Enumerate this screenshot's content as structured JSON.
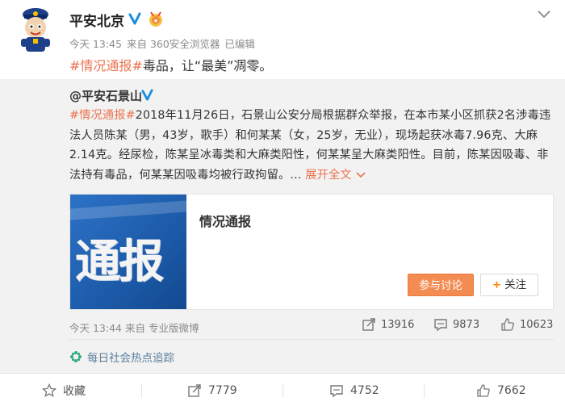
{
  "post": {
    "username": "平安北京",
    "meta_time": "今天 13:45",
    "meta_from": "来自 360安全浏览器",
    "meta_edited": "已编辑",
    "text_hashtag": "#情况通报#",
    "text_body": "毒品，让“最美”凋零。"
  },
  "repost": {
    "author": "@平安石景山",
    "text_hashtag": "#情况通报#",
    "text_body": "2018年11月26日，石景山公安分局根据群众举报，在本市某小区抓获2名涉毒违法人员陈某（男，43岁，歌手）和何某某（女，25岁，无业），现场起获冰毒7.96克、大麻2.14克。经尿检，陈某呈冰毒类和大麻类阳性，何某某呈大麻类阳性。目前，陈某因吸毒、非法持有毒品，何某某因吸毒均被行政拘留。...",
    "expand_label": "展开全文",
    "card": {
      "image_text": "通报",
      "title": "情况通报",
      "discuss_label": "参与讨论",
      "follow_label": "关注"
    },
    "meta": "今天 13:44 来自 专业版微博",
    "stats": {
      "reposts": "13916",
      "comments": "9873",
      "likes": "10623"
    },
    "topic_label": "每日社会热点追踪"
  },
  "footer": {
    "favorite_label": "收藏",
    "reposts": "7779",
    "comments": "4752",
    "likes": "7662"
  },
  "colors": {
    "accent": "#eb7350",
    "button": "#f28c52",
    "topic": "#5a7f9c"
  }
}
